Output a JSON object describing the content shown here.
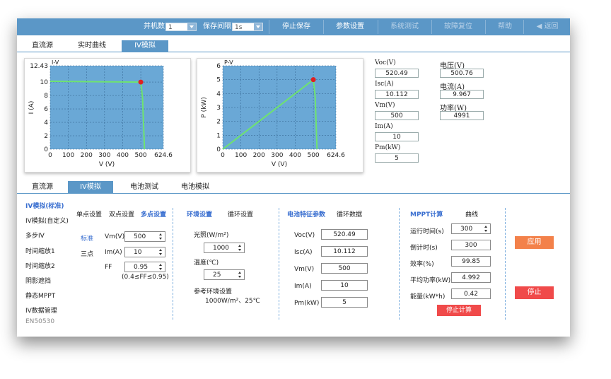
{
  "toolbar": {
    "parallel_label": "并机数",
    "parallel_value": "1",
    "save_interval_label": "保存间隔",
    "save_interval_value": "1s",
    "stop_save": "停止保存",
    "param_settings": "参数设置",
    "system_test": "系统测试",
    "fault_reset": "故障复位",
    "help": "帮助",
    "back": "返回"
  },
  "top_tabs": [
    "直流源",
    "实时曲线",
    "IV模拟"
  ],
  "iv_chart": {
    "ylabel_top": "I-V",
    "ylabel": "I (A)",
    "xlabel": "V (V)",
    "y_ticks": [
      "0",
      "2",
      "4",
      "6",
      "8",
      "10",
      "12.43"
    ],
    "x_ticks": [
      "0",
      "100",
      "200",
      "300",
      "400",
      "500",
      "624.6"
    ]
  },
  "pv_chart": {
    "ylabel_top": "P-V",
    "ylabel": "P (kW)",
    "xlabel": "V (V)",
    "y_ticks": [
      "0",
      "1",
      "2",
      "3",
      "4",
      "5",
      "6"
    ],
    "x_ticks": [
      "0",
      "100",
      "200",
      "300",
      "400",
      "500",
      "624.6"
    ]
  },
  "chart_data": [
    {
      "type": "line",
      "title": "",
      "xlabel": "V (V)",
      "ylabel": "I (A)",
      "xlim": [
        0,
        624.6
      ],
      "ylim": [
        0,
        12.43
      ],
      "grid": true,
      "series": [
        {
          "x": [
            0,
            500,
            510,
            520.49
          ],
          "y": [
            10.112,
            10.0,
            7.5,
            0
          ]
        }
      ],
      "mpp": {
        "x": 500,
        "y": 10
      }
    },
    {
      "type": "line",
      "title": "",
      "xlabel": "V (V)",
      "ylabel": "P (kW)",
      "xlim": [
        0,
        624.6
      ],
      "ylim": [
        0,
        6
      ],
      "grid": true,
      "series": [
        {
          "x": [
            0,
            500,
            510,
            520.49
          ],
          "y": [
            0,
            5.0,
            3.8,
            0
          ]
        }
      ],
      "mpp": {
        "x": 500,
        "y": 5
      }
    }
  ],
  "readout": {
    "voc_label": "Voc(V)",
    "voc": "520.49",
    "isc_label": "Isc(A)",
    "isc": "10.112",
    "vm_label": "Vm(V)",
    "vm": "500",
    "im_label": "Im(A)",
    "im": "10",
    "pm_label": "Pm(kW)",
    "pm": "5",
    "voltage_label": "电压(V)",
    "voltage": "500.76",
    "current_label": "电流(A)",
    "current": "9.967",
    "power_label": "功率(W)",
    "power": "4991"
  },
  "bottom_tabs": [
    "直流源",
    "IV模拟",
    "电池测试",
    "电池模拟"
  ],
  "left_menu": [
    "IV模拟(标准)",
    "IV模拟(自定义)",
    "多步IV",
    "时间缩放1",
    "时间缩放2",
    "阴影遮挡",
    "静态MPPT",
    "IV数据管理"
  ],
  "model_id": "EN50530",
  "point_setting": {
    "single": "单点设置",
    "double": "双点设置",
    "multi": "多点设置",
    "standard": "标准",
    "three_point": "三点",
    "vm_label": "Vm(V)",
    "vm": "500",
    "im_label": "Im(A)",
    "im": "10",
    "ff_label": "FF",
    "ff": "0.95",
    "ff_range": "(0.4≤FF≤0.95)"
  },
  "env": {
    "env_setting": "环境设置",
    "loop_setting": "循环设置",
    "irradiance_label": "光照(W/m²)",
    "irradiance": "1000",
    "temp_label": "温度(℃)",
    "temp": "25",
    "ref_label": "参考环境设置",
    "ref_value": "1000W/m²、25℃"
  },
  "battery": {
    "params": "电池特征参数",
    "loop_data": "循环数据",
    "voc_label": "Voc(V)",
    "voc": "520.49",
    "isc_label": "Isc(A)",
    "isc": "10.112",
    "vm_label": "Vm(V)",
    "vm": "500",
    "im_label": "Im(A)",
    "im": "10",
    "pm_label": "Pm(kW)",
    "pm": "5"
  },
  "mppt": {
    "title": "MPPT计算",
    "curve": "曲线",
    "run_time_label": "运行时间(s)",
    "run_time": "300",
    "countdown_label": "倒计时(s)",
    "countdown": "300",
    "efficiency_label": "效率(%)",
    "efficiency": "99.85",
    "avg_power_label": "平均功率(kW)",
    "avg_power": "4.992",
    "energy_label": "能量(kW*h)",
    "energy": "0.42",
    "stop_calc": "停止计算"
  },
  "actions": {
    "apply": "应用",
    "stop": "停止"
  },
  "colors": {
    "toolbar": "#5b97c7",
    "plot_bg": "#6aa8d6",
    "curve": "#6fe36f",
    "mpp": "#e02020",
    "apply": "#f3814a",
    "stop": "#f04a4a"
  }
}
